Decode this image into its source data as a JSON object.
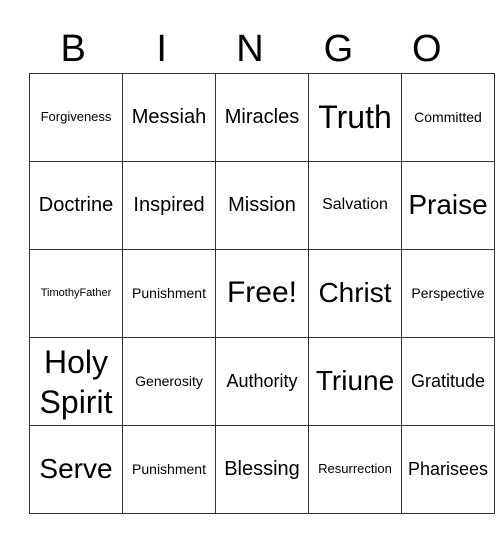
{
  "header": [
    "B",
    "I",
    "N",
    "G",
    "O"
  ],
  "rows": [
    [
      "Forgiveness",
      "Messiah",
      "Miracles",
      "Truth",
      "Committed"
    ],
    [
      "Doctrine",
      "Inspired",
      "Mission",
      "Salvation",
      "Praise"
    ],
    [
      "TimothyFather",
      "Punishment",
      "Free!",
      "Christ",
      "Perspective"
    ],
    [
      "Holy Spirit",
      "Generosity",
      "Authority",
      "Triune",
      "Gratitude"
    ],
    [
      "Serve",
      "Punishment",
      "Blessing",
      "Resurrection",
      "Pharisees"
    ]
  ]
}
